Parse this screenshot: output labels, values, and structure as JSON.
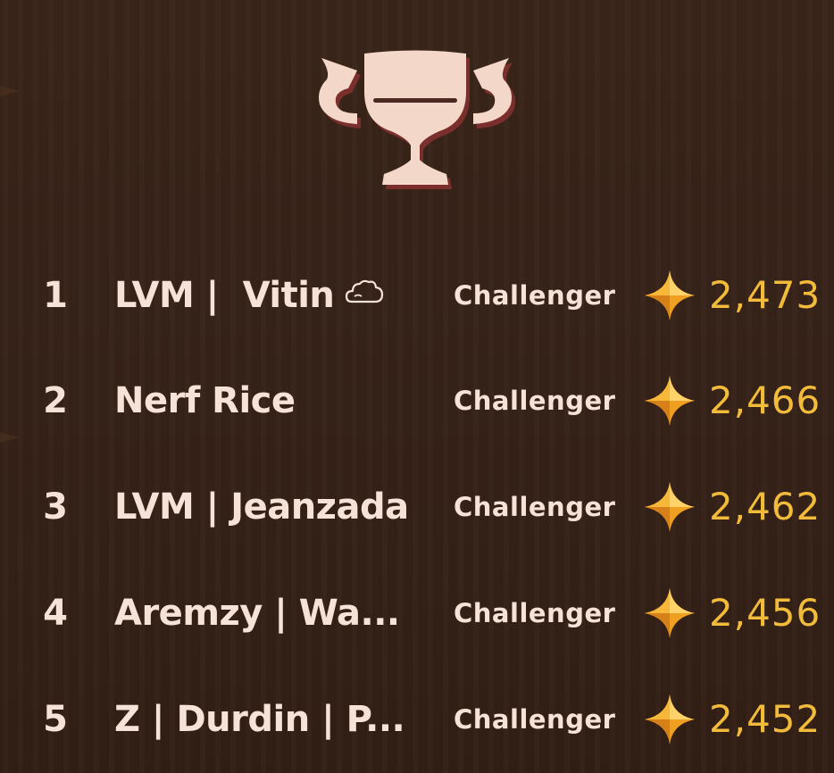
{
  "leaderboard": {
    "trophy_icon": "trophy-icon",
    "rows": [
      {
        "rank": "1",
        "name": "LVM |  Vitin",
        "badge_icon": "cloud-icon",
        "tier": "Challenger",
        "points_icon": "star-icon",
        "points": "2,473"
      },
      {
        "rank": "2",
        "name": "Nerf Rice",
        "tier": "Challenger",
        "points_icon": "star-icon",
        "points": "2,466"
      },
      {
        "rank": "3",
        "name": "LVM | Jeanzada",
        "tier": "Challenger",
        "points_icon": "star-icon",
        "points": "2,462"
      },
      {
        "rank": "4",
        "name": "Aremzy | Wa...",
        "tier": "Challenger",
        "points_icon": "star-icon",
        "points": "2,456"
      },
      {
        "rank": "5",
        "name": "Z | Durdin | P...",
        "tier": "Challenger",
        "points_icon": "star-icon",
        "points": "2,452"
      }
    ]
  },
  "colors": {
    "background": "#362218",
    "text": "#f6e2d6",
    "points": "#f2bc3a",
    "trophy_fill": "#f3d7c8",
    "trophy_shadow": "#7a2f2c"
  }
}
